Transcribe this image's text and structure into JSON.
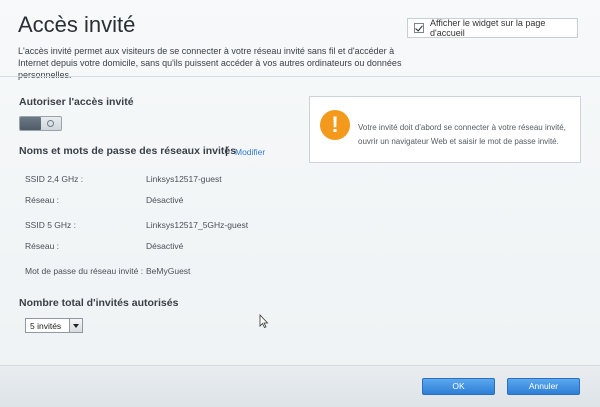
{
  "header": {
    "title": "Accès invité",
    "widget_checkbox_label": "Afficher le widget sur la page d'accueil",
    "widget_checked": true
  },
  "description": "L'accès invité permet aux visiteurs de se connecter à votre réseau invité sans fil et d'accéder à Internet depuis votre domicile, sans qu'ils puissent accéder à vos autres ordinateurs ou données personnelles.",
  "guest_access": {
    "heading": "Autoriser l'accès invité",
    "toggle_state": "off"
  },
  "networks": {
    "heading": "Noms et mots de passe des réseaux invités",
    "separator": "|",
    "modify_label": "Modifier",
    "rows": [
      {
        "label": "SSID 2,4 GHz :",
        "value": "Linksys12517-guest"
      },
      {
        "label": "Réseau :",
        "value": "Désactivé"
      },
      {
        "label": "SSID 5 GHz :",
        "value": "Linksys12517_5GHz-guest"
      },
      {
        "label": "Réseau :",
        "value": "Désactivé"
      },
      {
        "label": "Mot de passe du réseau invité :",
        "value": "BeMyGuest"
      }
    ]
  },
  "info": {
    "icon": "warning-icon",
    "icon_glyph": "!",
    "text": "Votre invité doit d'abord se connecter à votre réseau invité, ouvrir un navigateur Web et saisir le mot de passe invité.",
    "color": "#f39a1c"
  },
  "guests": {
    "heading": "Nombre total d'invités autorisés",
    "selected": "5 invités"
  },
  "footer": {
    "ok_label": "OK",
    "cancel_label": "Annuler",
    "button_color": "#2d7ed6"
  }
}
